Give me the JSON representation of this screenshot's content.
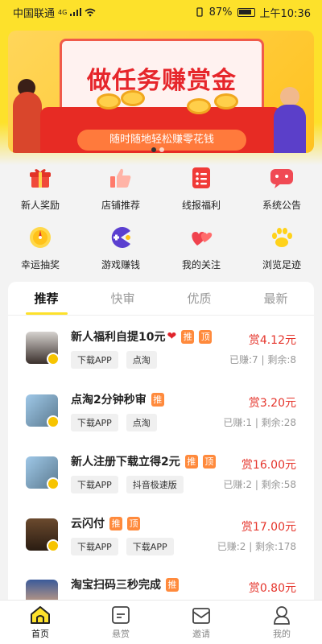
{
  "status_bar": {
    "carrier": "中国联通",
    "network": "4G",
    "battery": "87%",
    "time": "上午10:36"
  },
  "banner": {
    "title": "做任务赚赏金",
    "subtitle": "随时随地轻松赚零花钱"
  },
  "grid": [
    {
      "label": "新人奖励",
      "icon": "gift-icon"
    },
    {
      "label": "店铺推荐",
      "icon": "thumbs-up-icon"
    },
    {
      "label": "线报福利",
      "icon": "list-icon"
    },
    {
      "label": "系统公告",
      "icon": "message-icon"
    },
    {
      "label": "幸运抽奖",
      "icon": "lottery-icon"
    },
    {
      "label": "游戏赚钱",
      "icon": "game-icon"
    },
    {
      "label": "我的关注",
      "icon": "hearts-icon"
    },
    {
      "label": "浏览足迹",
      "icon": "paw-icon"
    }
  ],
  "tabs": [
    "推荐",
    "快审",
    "优质",
    "最新"
  ],
  "tasks": [
    {
      "title": "新人福利自提10元",
      "emoji": "❤",
      "tags": [
        "推",
        "顶"
      ],
      "chips": [
        "下载APP",
        "点淘"
      ],
      "reward": "赏4.12元",
      "earned": "已赚:7",
      "remaining": "剩余:8"
    },
    {
      "title": "点淘2分钟秒审",
      "emoji": "",
      "tags": [
        "推"
      ],
      "chips": [
        "下载APP",
        "点淘"
      ],
      "reward": "赏3.20元",
      "earned": "已赚:1",
      "remaining": "剩余:28"
    },
    {
      "title": "新人注册下载立得2元",
      "emoji": "",
      "tags": [
        "推",
        "顶"
      ],
      "chips": [
        "下载APP",
        "抖音极速版"
      ],
      "reward": "赏16.00元",
      "earned": "已赚:2",
      "remaining": "剩余:58"
    },
    {
      "title": "云闪付",
      "emoji": "",
      "tags": [
        "推",
        "顶"
      ],
      "chips": [
        "下载APP",
        "下载APP"
      ],
      "reward": "赏17.00元",
      "earned": "已赚:2",
      "remaining": "剩余:178"
    },
    {
      "title": "淘宝扫码三秒完成",
      "emoji": "",
      "tags": [
        "推"
      ],
      "chips": [],
      "reward": "赏0.80元",
      "earned": "",
      "remaining": ""
    }
  ],
  "bottom_nav": [
    {
      "label": "首页",
      "icon": "home-icon",
      "active": true
    },
    {
      "label": "悬赏",
      "icon": "reward-icon",
      "active": false
    },
    {
      "label": "邀请",
      "icon": "invite-icon",
      "active": false
    },
    {
      "label": "我的",
      "icon": "profile-icon",
      "active": false
    }
  ],
  "colors": {
    "brand_yellow": "#fde12b",
    "reward_red": "#e5352c",
    "tag_orange": "#ff8a3c"
  }
}
